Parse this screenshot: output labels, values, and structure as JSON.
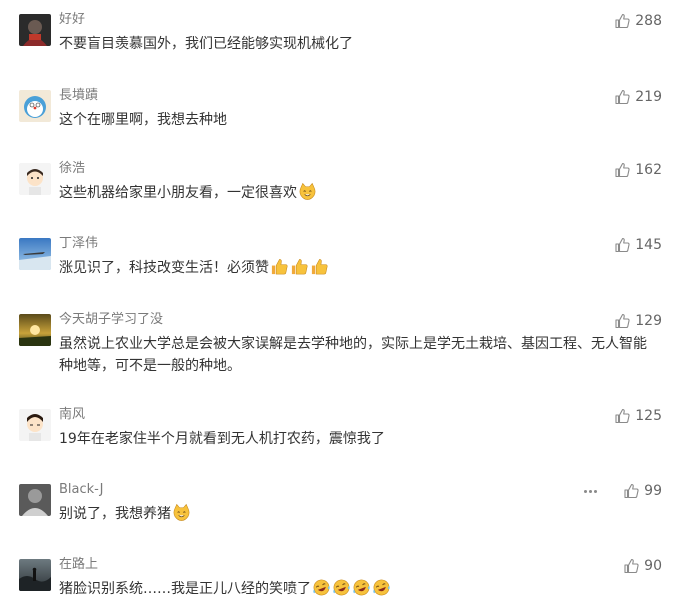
{
  "colors": {
    "username": "#7a7a7a",
    "text": "#333333",
    "like_icon": "#8a8a8a",
    "background": "#ffffff"
  },
  "comments": [
    {
      "username": "好好",
      "text": "不要盲目羡慕国外，我们已经能够实现机械化了",
      "likes": "288",
      "emojis": []
    },
    {
      "username": "長墳蹟",
      "text": "这个在哪里啊，我想去种地",
      "likes": "219",
      "emojis": []
    },
    {
      "username": "徐浩",
      "text": "这些机器给家里小朋友看，一定很喜欢",
      "likes": "162",
      "emojis": [
        "cat-emoji"
      ]
    },
    {
      "username": "丁泽伟",
      "text": "涨见识了，科技改变生活！必须赞",
      "likes": "145",
      "emojis": [
        "thumbs-up-emoji",
        "thumbs-up-emoji",
        "thumbs-up-emoji"
      ]
    },
    {
      "username": "今天胡子学习了没",
      "text": "虽然说上农业大学总是会被大家误解是去学种地的，实际上是学无土栽培、基因工程、无人智能种地等，可不是一般的种地。",
      "likes": "129",
      "emojis": []
    },
    {
      "username": "南风",
      "text": "19年在老家住半个月就看到无人机打农药，震惊我了",
      "likes": "125",
      "emojis": []
    },
    {
      "username": "Black-J",
      "text": "别说了，我想养猪",
      "likes": "99",
      "emojis": [
        "cat-emoji"
      ],
      "has_more_menu": true
    },
    {
      "username": "在路上",
      "text": "猪脸识别系统……我是正儿八经的笑喷了",
      "likes": "90",
      "emojis": [
        "laugh-cry-emoji",
        "laugh-cry-emoji",
        "laugh-cry-emoji",
        "laugh-cry-emoji"
      ]
    }
  ]
}
